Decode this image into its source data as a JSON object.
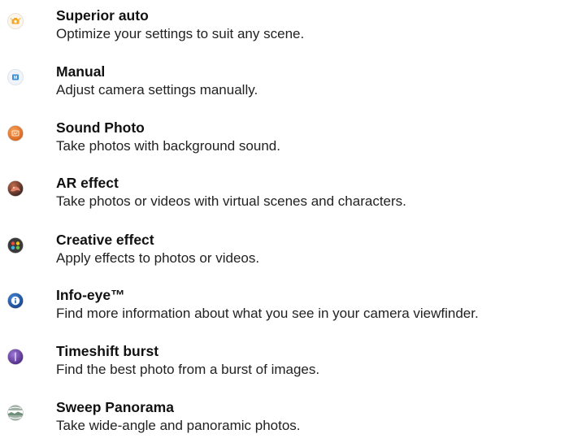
{
  "modes": [
    {
      "title": "Superior auto",
      "description": "Optimize your settings to suit any scene.",
      "icon": "superior-auto-icon"
    },
    {
      "title": "Manual",
      "description": "Adjust camera settings manually.",
      "icon": "manual-icon"
    },
    {
      "title": "Sound Photo",
      "description": "Take photos with background sound.",
      "icon": "sound-photo-icon"
    },
    {
      "title": "AR effect",
      "description": "Take photos or videos with virtual scenes and characters.",
      "icon": "ar-effect-icon"
    },
    {
      "title": "Creative effect",
      "description": "Apply effects to photos or videos.",
      "icon": "creative-effect-icon"
    },
    {
      "title": "Info-eye™",
      "description": "Find more information about what you see in your camera viewfinder.",
      "icon": "info-eye-icon"
    },
    {
      "title": "Timeshift burst",
      "description": "Find the best photo from a burst of images.",
      "icon": "timeshift-burst-icon"
    },
    {
      "title": "Sweep Panorama",
      "description": "Take wide-angle and panoramic photos.",
      "icon": "sweep-panorama-icon"
    }
  ],
  "icon_colors": {
    "superior_auto": "#f5a623",
    "manual": "#3a8fd9",
    "sound_photo": "#e8742a",
    "ar_effect": "#8a3b2a",
    "creative_effect": "#3a3a3a",
    "info_eye": "#1f5fb8",
    "timeshift_burst": "#6a3fa8",
    "sweep_panorama": "#6f8f7a"
  }
}
